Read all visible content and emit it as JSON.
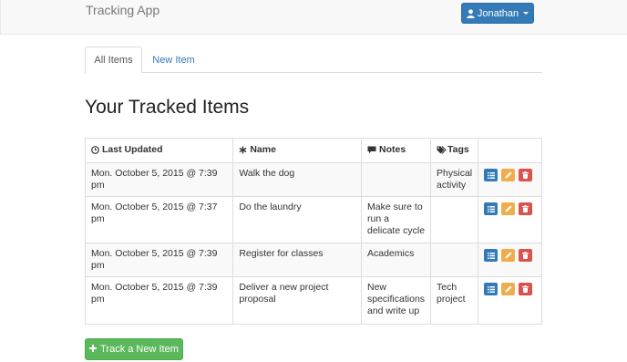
{
  "app": {
    "title": "Tracking App"
  },
  "user": {
    "name": "Jonathan",
    "icon": "user-icon"
  },
  "tabs": [
    {
      "label": "All Items",
      "active": true
    },
    {
      "label": "New Item",
      "active": false
    }
  ],
  "page": {
    "title": "Your Tracked Items"
  },
  "table": {
    "headers": [
      {
        "label": "Last Updated",
        "icon": "clock-icon"
      },
      {
        "label": "Name",
        "icon": "asterisk-icon"
      },
      {
        "label": "Notes",
        "icon": "comment-icon"
      },
      {
        "label": "Tags",
        "icon": "tags-icon"
      }
    ],
    "rows": [
      {
        "updated": "Mon. October 5, 2015 @ 7:39 pm",
        "name": "Walk the dog",
        "notes": "",
        "tags": "Physical activity"
      },
      {
        "updated": "Mon. October 5, 2015 @ 7:37 pm",
        "name": "Do the laundry",
        "notes": "Make sure to run a delicate cycle",
        "tags": ""
      },
      {
        "updated": "Mon. October 5, 2015 @ 7:39 pm",
        "name": "Register for classes",
        "notes": "Academics",
        "tags": ""
      },
      {
        "updated": "Mon. October 5, 2015 @ 7:39 pm",
        "name": "Deliver a new project proposal",
        "notes": "New specifications and write up",
        "tags": "Tech project"
      }
    ],
    "row_actions": [
      "list-icon",
      "pencil-icon",
      "trash-icon"
    ]
  },
  "add_button": {
    "label": "Track a New Item",
    "icon": "plus-icon"
  },
  "colors": {
    "primary": "#337ab7",
    "warning": "#f0ad4e",
    "danger": "#d9534f",
    "success": "#5cb85c"
  }
}
